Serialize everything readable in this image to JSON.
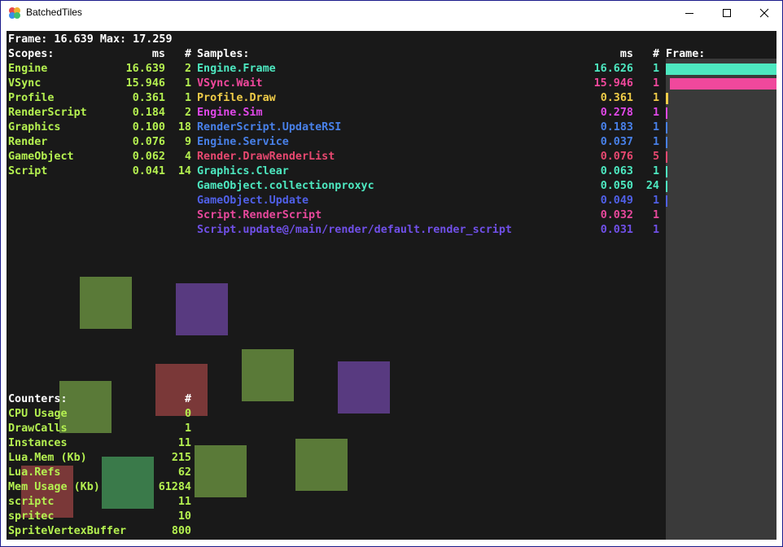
{
  "window": {
    "title": "BatchedTiles",
    "buttons": {
      "minimize": "minimize-icon",
      "maximize": "maximize-icon",
      "close": "close-icon"
    }
  },
  "profiler": {
    "frame_line": "Frame: 16.639 Max: 17.259",
    "scopes": {
      "header": {
        "name": "Scopes:",
        "ms": "ms",
        "count": "#"
      },
      "rows": [
        {
          "name": "Engine",
          "ms": "16.639",
          "count": "2"
        },
        {
          "name": "VSync",
          "ms": "15.946",
          "count": "1"
        },
        {
          "name": "Profile",
          "ms": "0.361",
          "count": "1"
        },
        {
          "name": "RenderScript",
          "ms": "0.184",
          "count": "2"
        },
        {
          "name": "Graphics",
          "ms": "0.100",
          "count": "18"
        },
        {
          "name": "Render",
          "ms": "0.076",
          "count": "9"
        },
        {
          "name": "GameObject",
          "ms": "0.062",
          "count": "4"
        },
        {
          "name": "Script",
          "ms": "0.041",
          "count": "14"
        }
      ]
    },
    "samples": {
      "header": {
        "name": "Samples:",
        "ms": "ms",
        "count": "#",
        "frame": "Frame:"
      },
      "rows": [
        {
          "name": "Engine.Frame",
          "ms": "16.626",
          "count": "1",
          "color": "#4de8c0",
          "bar_fraction": 1.0,
          "bar_start": 0.0
        },
        {
          "name": "VSync.Wait",
          "ms": "15.946",
          "count": "1",
          "color": "#f0489c",
          "bar_fraction": 0.96,
          "bar_start": 0.04
        },
        {
          "name": "Profile.Draw",
          "ms": "0.361",
          "count": "1",
          "color": "#f0cc48",
          "bar_fraction": 0.02,
          "bar_start": 0.0
        },
        {
          "name": "Engine.Sim",
          "ms": "0.278",
          "count": "1",
          "color": "#e048e8",
          "bar_fraction": 0.015,
          "bar_start": 0.0
        },
        {
          "name": "RenderScript.UpdateRSI",
          "ms": "0.183",
          "count": "1",
          "color": "#4880e8",
          "bar_fraction": 0.01,
          "bar_start": 0.0
        },
        {
          "name": "Engine.Service",
          "ms": "0.037",
          "count": "1",
          "color": "#4880e8",
          "bar_fraction": 0.005,
          "bar_start": 0.0
        },
        {
          "name": "Render.DrawRenderList",
          "ms": "0.076",
          "count": "5",
          "color": "#e84870",
          "bar_fraction": 0.01,
          "bar_start": 0.0
        },
        {
          "name": "Graphics.Clear",
          "ms": "0.063",
          "count": "1",
          "color": "#4de8c0",
          "bar_fraction": 0.005,
          "bar_start": 0.0
        },
        {
          "name": "GameObject.collectionproxyc",
          "ms": "0.050",
          "count": "24",
          "color": "#4de8c0",
          "bar_fraction": 0.01,
          "bar_start": 0.0
        },
        {
          "name": "GameObject.Update",
          "ms": "0.049",
          "count": "1",
          "color": "#5060e8",
          "bar_fraction": 0.005,
          "bar_start": 0.0
        },
        {
          "name": "Script.RenderScript",
          "ms": "0.032",
          "count": "1",
          "color": "#e8489c",
          "bar_fraction": 0.0,
          "bar_start": 0.0
        },
        {
          "name": "Script.update@/main/render/default.render_script",
          "ms": "0.031",
          "count": "1",
          "color": "#7050e8",
          "bar_fraction": 0.0,
          "bar_start": 0.0
        }
      ]
    },
    "counters": {
      "header": {
        "name": "Counters:",
        "count": "#"
      },
      "rows": [
        {
          "name": "CPU Usage",
          "count": "0"
        },
        {
          "name": "DrawCalls",
          "count": "1"
        },
        {
          "name": "Instances",
          "count": "11"
        },
        {
          "name": "Lua.Mem (Kb)",
          "count": "215"
        },
        {
          "name": "Lua.Refs",
          "count": "62"
        },
        {
          "name": "Mem Usage (Kb)",
          "count": "61284"
        },
        {
          "name": "scriptc",
          "count": "11"
        },
        {
          "name": "spritec",
          "count": "10"
        },
        {
          "name": "SpriteVertexBuffer",
          "count": "800"
        }
      ]
    }
  },
  "colors": {
    "text_white": "#ffffff",
    "text_green": "#b4f050",
    "frame_panel": "#3a3a3a",
    "canvas_bg": "#191919"
  }
}
